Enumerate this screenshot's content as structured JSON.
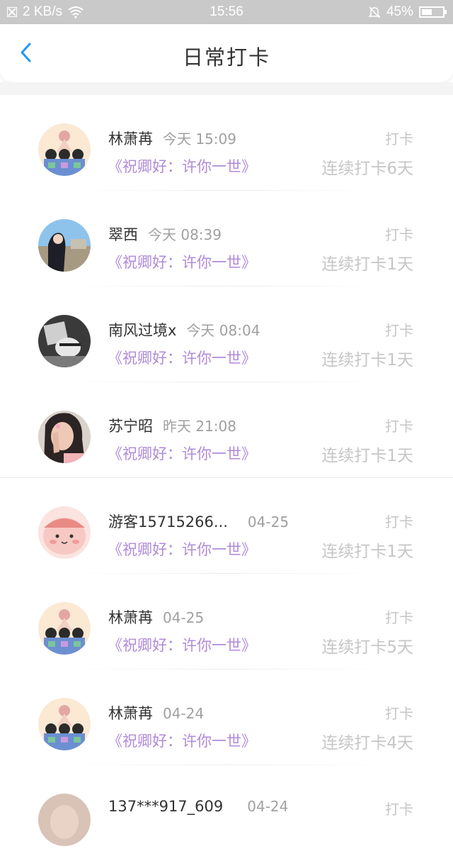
{
  "status": {
    "speed": "2 KB/s",
    "time": "15:56",
    "battery": "45%"
  },
  "nav": {
    "title": "日常打卡"
  },
  "entries": [
    {
      "name": "林萧苒",
      "time": "今天 15:09",
      "book": "《祝卿好：许你一世》",
      "tag": "打卡",
      "streak": "连续打卡6天",
      "avatar": "cartoon-group"
    },
    {
      "name": "翠西",
      "time": "今天 08:39",
      "book": "《祝卿好：许你一世》",
      "tag": "打卡",
      "streak": "连续打卡1天",
      "avatar": "girl-sky"
    },
    {
      "name": "南风过境x",
      "time": "今天 08:04",
      "book": "《祝卿好：许你一世》",
      "tag": "打卡",
      "streak": "连续打卡1天",
      "avatar": "dark-photo"
    },
    {
      "name": "苏宁昭",
      "time": "昨天 21:08",
      "book": "《祝卿好：许你一世》",
      "tag": "打卡",
      "streak": "连续打卡1天",
      "avatar": "girl-pink"
    },
    {
      "name": "游客15715266...",
      "time": "04-25",
      "book": "《祝卿好：许你一世》",
      "tag": "打卡",
      "streak": "连续打卡1天",
      "avatar": "pink-blob"
    },
    {
      "name": "林萧苒",
      "time": "04-25",
      "book": "《祝卿好：许你一世》",
      "tag": "打卡",
      "streak": "连续打卡5天",
      "avatar": "cartoon-group"
    },
    {
      "name": "林萧苒",
      "time": "04-24",
      "book": "《祝卿好：许你一世》",
      "tag": "打卡",
      "streak": "连续打卡4天",
      "avatar": "cartoon-group"
    },
    {
      "name": "137***917_609",
      "time": "04-24",
      "book": "",
      "tag": "打卡",
      "streak": "",
      "avatar": "photo"
    }
  ]
}
